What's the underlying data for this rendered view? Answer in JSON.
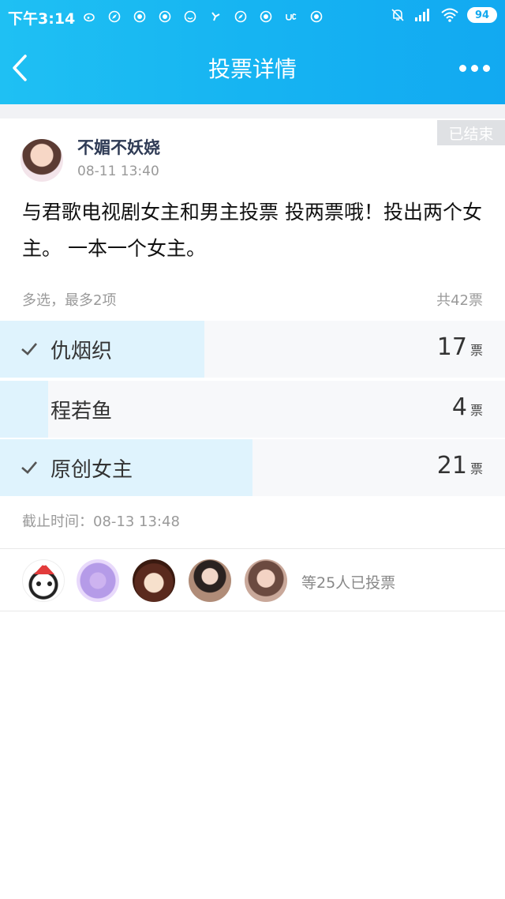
{
  "status_bar": {
    "time": "下午3:14",
    "notification_icons": [
      "weibo-icon",
      "compass-icon",
      "qq-icon",
      "qq-icon",
      "smile-icon",
      "fan-icon",
      "compass-icon",
      "qq-icon",
      "uc-icon",
      "qq-icon"
    ],
    "battery": "94"
  },
  "navbar": {
    "title": "投票详情"
  },
  "post": {
    "ended_tag": "已结束",
    "author": "不媚不妖娆",
    "time": "08-11 13:40",
    "content": "与君歌电视剧女主和男主投票 投两票哦！投出两个女主。 一本一个女主。"
  },
  "vote": {
    "rule": "多选，最多2项",
    "total": "共42票",
    "unit": "票",
    "options": [
      {
        "label": "仇烟织",
        "count": "17",
        "share": 0.405,
        "checked": true
      },
      {
        "label": "程若鱼",
        "count": "4",
        "share": 0.095,
        "checked": false
      },
      {
        "label": "原创女主",
        "count": "21",
        "share": 0.5,
        "checked": true
      }
    ],
    "deadline": "截止时间：08-13 13:48"
  },
  "voters": {
    "summary": "等25人已投票",
    "avatars": [
      "panda-santa-avatar",
      "purple-cartoon-avatar",
      "anime-boy-avatar",
      "woman-portrait-avatar",
      "girl-portrait-avatar"
    ]
  },
  "colors": {
    "header": "#16b4f2",
    "option_fill": "#dff3fd",
    "option_bg": "#f7f8fa",
    "author_name": "#2f3b55"
  }
}
